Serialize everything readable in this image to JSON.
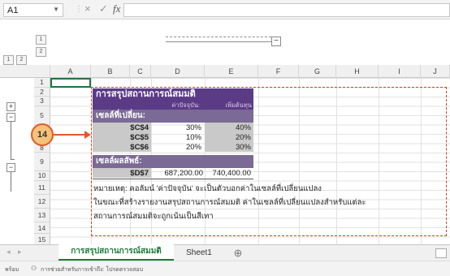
{
  "formula_bar": {
    "name_box": "A1",
    "cancel_icon": "×",
    "enter_icon": "✓",
    "fx_label": "fx"
  },
  "outline": {
    "levels_col": [
      "1",
      "2"
    ],
    "levels_row": [
      "1",
      "2"
    ],
    "plus": "+",
    "minus": "−"
  },
  "columns": [
    "A",
    "B",
    "C",
    "D",
    "E",
    "F",
    "G",
    "H",
    "I",
    "J"
  ],
  "rows": [
    "1",
    "2",
    "3",
    "5",
    "6",
    "7",
    "8",
    "9",
    "10",
    "11",
    "12",
    "13",
    "14",
    "15"
  ],
  "scenario": {
    "title": "การสรุปสถานการณ์สมมติ",
    "col_current": "ค่าปัจจุบัน:",
    "col_increase": "เพิ่มต้นทุน",
    "changing_header": "เซลล์ที่เปลี่ยน:",
    "changing_cells": [
      {
        "ref": "$C$4",
        "current": "30%",
        "scenario": "40%"
      },
      {
        "ref": "$C$5",
        "current": "10%",
        "scenario": "20%"
      },
      {
        "ref": "$C$6",
        "current": "20%",
        "scenario": "30%"
      }
    ],
    "result_header": "เซลล์ผลลัพธ์:",
    "result": {
      "ref": "$D$7",
      "current": "687,200.00",
      "scenario": "740,400.00"
    },
    "notes": [
      "หมายเหตุ: คอลัมน์ 'ค่าปัจจุบัน' จะเป็นตัวบอกค่าในเซลล์ที่เปลี่ยนแปลง",
      "ในขณะที่สร้างรายงานสรุปสถานการณ์สมมติ ค่าในเซลล์ที่เปลี่ยนแปลงสำหรับแต่ละ",
      "สถานการณ์สมมติจะถูกเน้นเป็นสีเทา"
    ]
  },
  "callout": {
    "number": "14"
  },
  "tabs": {
    "active": "การสรุปสถานการณ์สมมติ",
    "other": "Sheet1",
    "add": "⊕"
  },
  "status": {
    "ready": "พร้อม",
    "hint": "การช่วยสำหรับการเข้าถึง: โปรดตรวจสอบ"
  },
  "colors": {
    "title_bg": "#5b3a86",
    "header_bg": "#7a6a95",
    "callout_fill": "#f5c27a",
    "callout_border": "#e05a2b",
    "dotted_border": "#e0401c",
    "tab_text": "#1e7a3a",
    "gray_cell": "#c9c9c9"
  }
}
